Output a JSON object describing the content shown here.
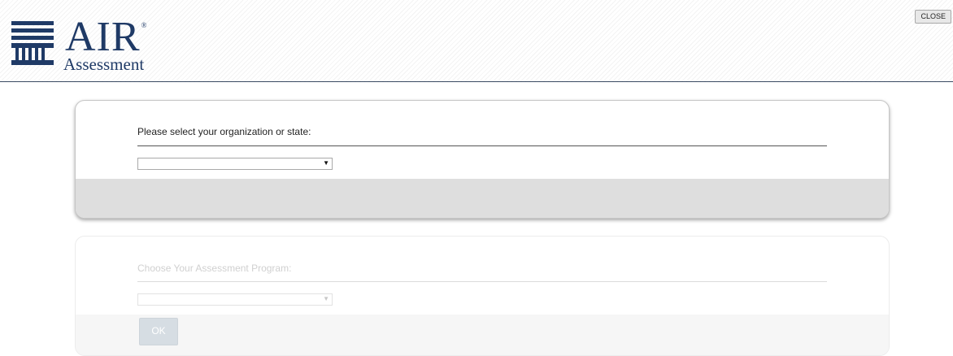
{
  "header": {
    "logo_text": "AIR",
    "logo_registered": "®",
    "logo_subtext": "Assessment",
    "close_label": "CLOSE"
  },
  "org_panel": {
    "label": "Please select your organization or state:",
    "selected_value": "",
    "arrow_glyph": "▼"
  },
  "program_panel": {
    "label": "Choose Your Assessment Program:",
    "selected_value": "",
    "arrow_glyph": "▼",
    "ok_label": "OK",
    "enabled": false
  },
  "colors": {
    "brand_navy": "#1f3a66",
    "header_rule": "#3a4a62",
    "footer_gray": "#dedede",
    "disabled_button": "#d6dde3"
  }
}
